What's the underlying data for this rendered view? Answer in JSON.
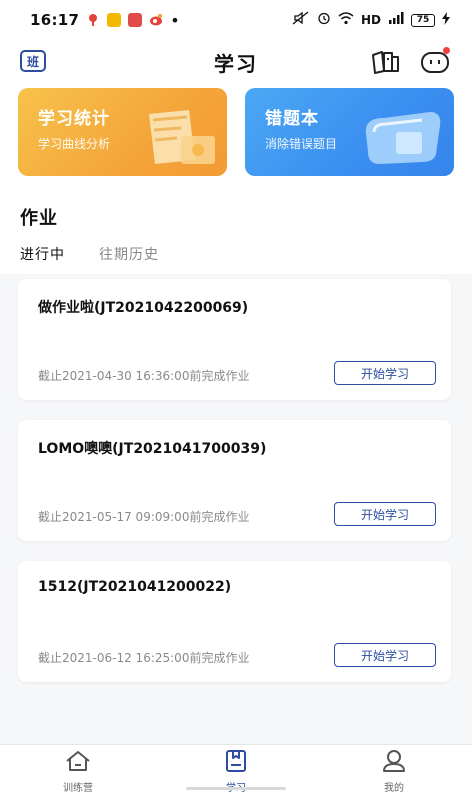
{
  "status_bar": {
    "time": "16:17",
    "network": "HD",
    "battery": "75",
    "notification_dot": "•"
  },
  "header": {
    "title": "学习",
    "class_badge": "班"
  },
  "feature_cards": [
    {
      "title": "学习统计",
      "subtitle": "学习曲线分析"
    },
    {
      "title": "错题本",
      "subtitle": "消除错误题目"
    }
  ],
  "section": {
    "title": "作业",
    "tabs": [
      {
        "label": "进行中",
        "active": true
      },
      {
        "label": "往期历史",
        "active": false
      }
    ]
  },
  "homework": [
    {
      "title": "做作业啦(JT2021042200069)",
      "deadline": "截止2021-04-30 16:36:00前完成作业",
      "button": "开始学习"
    },
    {
      "title": "LOMO噢噢(JT2021041700039)",
      "deadline": "截止2021-05-17 09:09:00前完成作业",
      "button": "开始学习"
    },
    {
      "title": "1512(JT2021041200022)",
      "deadline": "截止2021-06-12 16:25:00前完成作业",
      "button": "开始学习"
    }
  ],
  "bottom_nav": [
    {
      "label": "训练营",
      "icon": "home-icon",
      "active": false
    },
    {
      "label": "学习",
      "icon": "study-icon",
      "active": true
    },
    {
      "label": "我的",
      "icon": "profile-icon",
      "active": false
    }
  ],
  "colors": {
    "accent": "#2c4da0",
    "orange_card": "#f4a63a",
    "blue_card": "#3b8ff0"
  }
}
